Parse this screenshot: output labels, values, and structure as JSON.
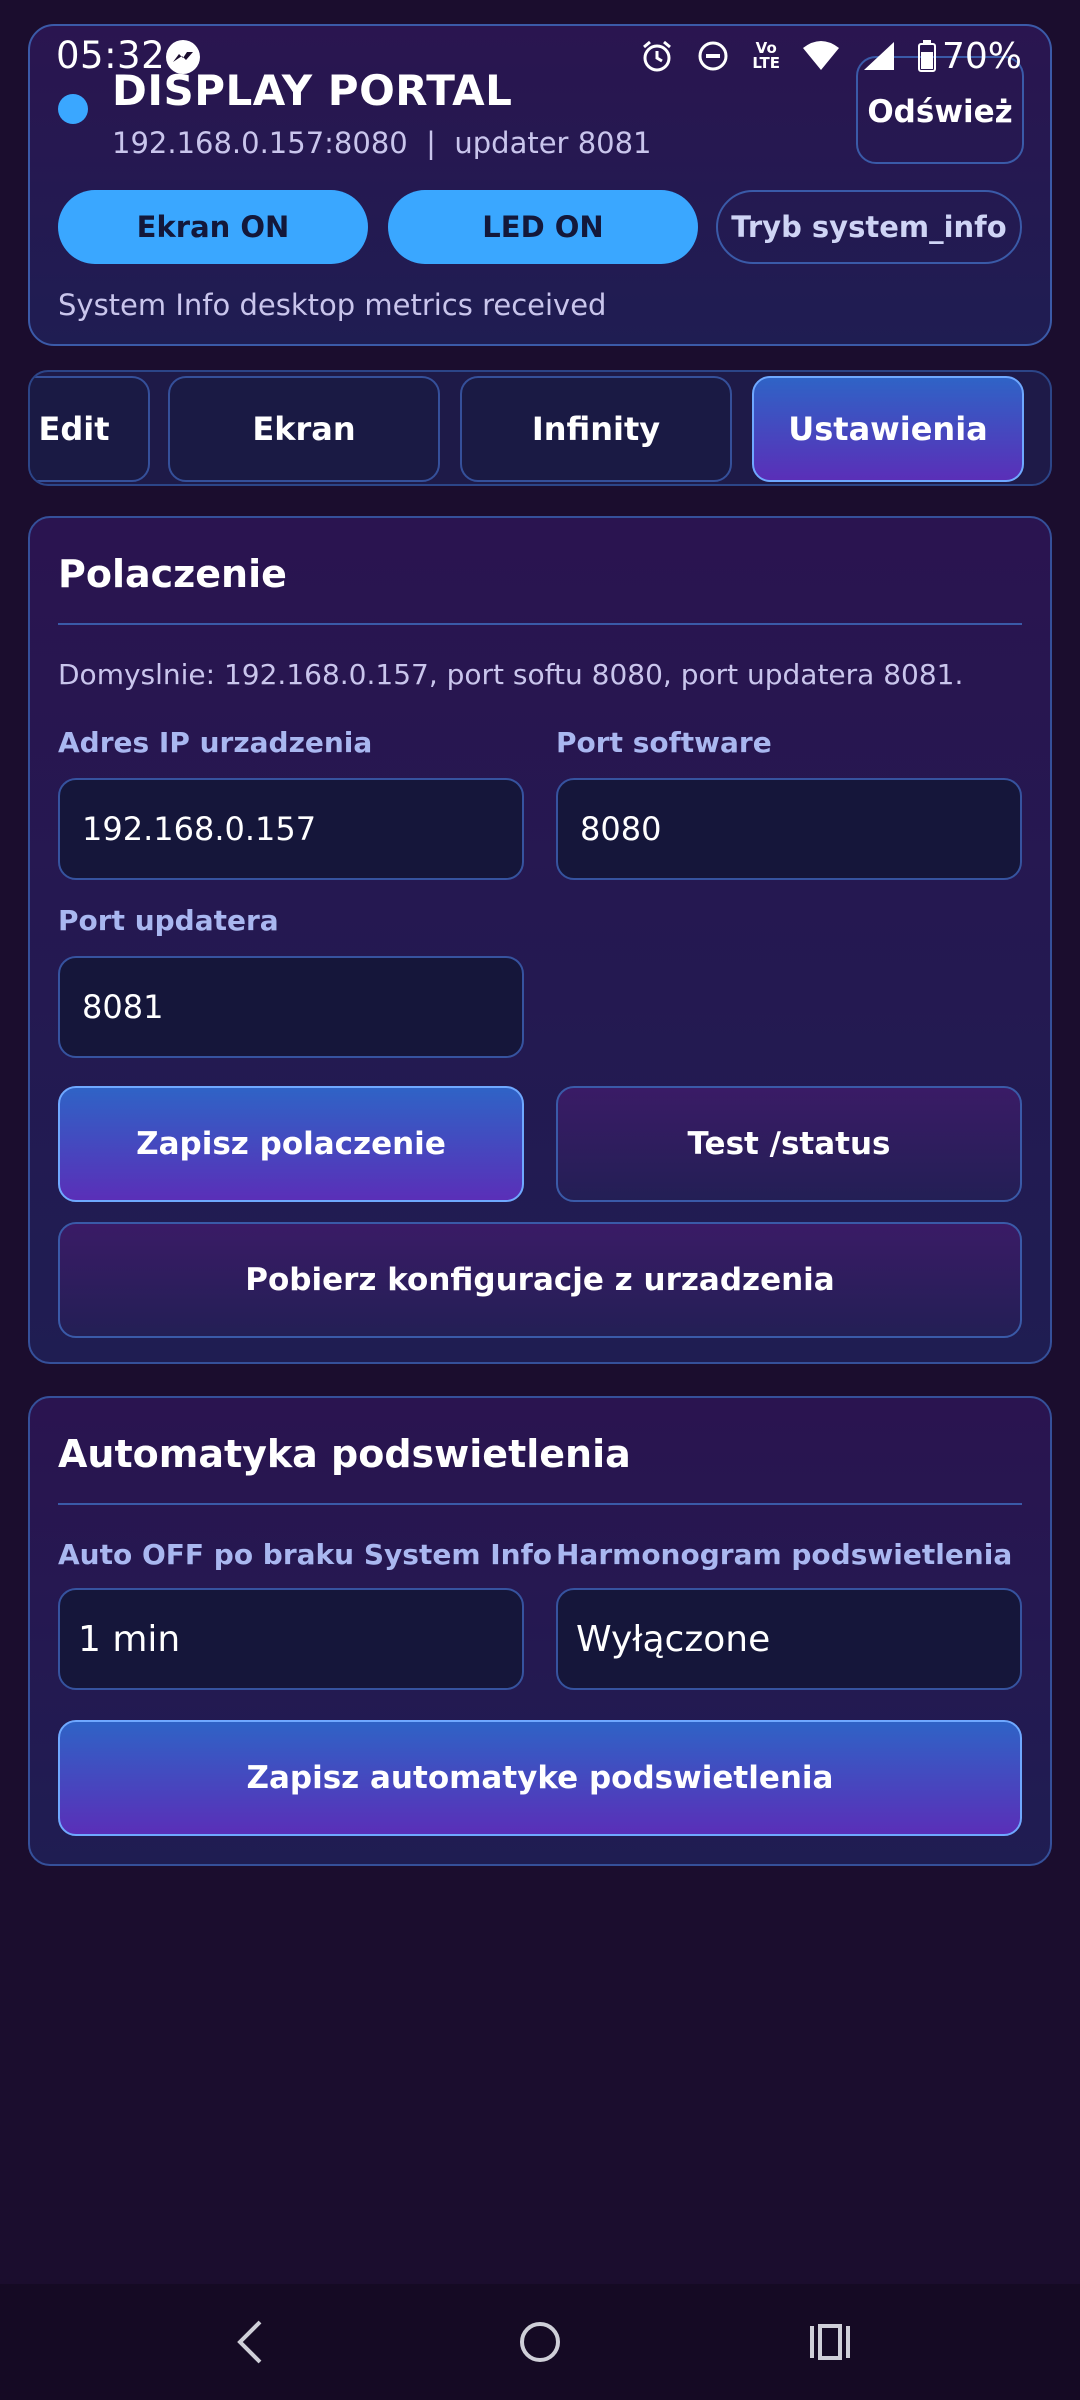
{
  "status_bar": {
    "time": "05:32",
    "battery": "70%",
    "network_label_top": "Vo",
    "network_label_bottom": "LTE",
    "icons": [
      "messenger-icon",
      "alarm-icon",
      "dnd-icon",
      "volte-icon",
      "wifi-icon",
      "signal-icon",
      "battery-icon"
    ]
  },
  "header": {
    "title": "DISPLAY PORTAL",
    "subtitle": "192.168.0.157:8080  |  updater 8081",
    "refresh_label": "Odśwież",
    "screen_on_label": "Ekran ON",
    "led_on_label": "LED ON",
    "mode_label": "Tryb system_info",
    "status_text": "System Info desktop metrics received",
    "accent_color": "#3aa7ff"
  },
  "tabs": [
    {
      "label": "Edit"
    },
    {
      "label": "Ekran"
    },
    {
      "label": "Infinity"
    },
    {
      "label": "Ustawienia",
      "active": true
    }
  ],
  "connection": {
    "title": "Polaczenie",
    "note": "Domyslnie: 192.168.0.157, port softu 8080, port updatera 8081.",
    "ip_label": "Adres IP urzadzenia",
    "ip_value": "192.168.0.157",
    "port_label": "Port software",
    "port_value": "8080",
    "updater_label": "Port updatera",
    "updater_value": "8081",
    "save_label": "Zapisz polaczenie",
    "test_label": "Test /status",
    "fetch_label": "Pobierz konfiguracje z urzadzenia"
  },
  "backlight": {
    "title": "Automatyka podswietlenia",
    "auto_off_label": "Auto OFF po braku System Info",
    "auto_off_value": "1 min",
    "schedule_label": "Harmonogram podswietlenia",
    "schedule_value": "Wyłączone",
    "save_label": "Zapisz automatyke podswietlenia"
  },
  "navbar": {
    "icons": [
      "back-icon",
      "home-icon",
      "recents-icon"
    ]
  }
}
